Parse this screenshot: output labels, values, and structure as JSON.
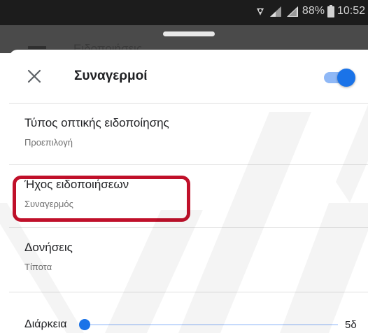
{
  "status_bar": {
    "battery_percent": "88%",
    "time": "10:52",
    "icons": [
      "vpn-key-icon",
      "signal-icon",
      "signal-icon",
      "battery-icon"
    ]
  },
  "background_screen": {
    "partial_title": "Ειδοποιήσεις"
  },
  "sheet": {
    "header": {
      "close_icon": "close-icon",
      "title": "Συναγερμοί",
      "toggle_on": true,
      "accent_color": "#1a73e8"
    },
    "settings": [
      {
        "title": "Τύπος οπτικής ειδοποίησης",
        "value": "Προεπιλογή"
      },
      {
        "title": "Ήχος ειδοποιήσεων",
        "value": "Συναγερμός"
      },
      {
        "title": "Δονήσεις",
        "value": "Τίποτα"
      }
    ],
    "duration": {
      "label": "Διάρκεια",
      "value": "5δ",
      "slider_fraction": 0.0
    }
  },
  "annotation": {
    "highlight_color": "#c0102a"
  }
}
